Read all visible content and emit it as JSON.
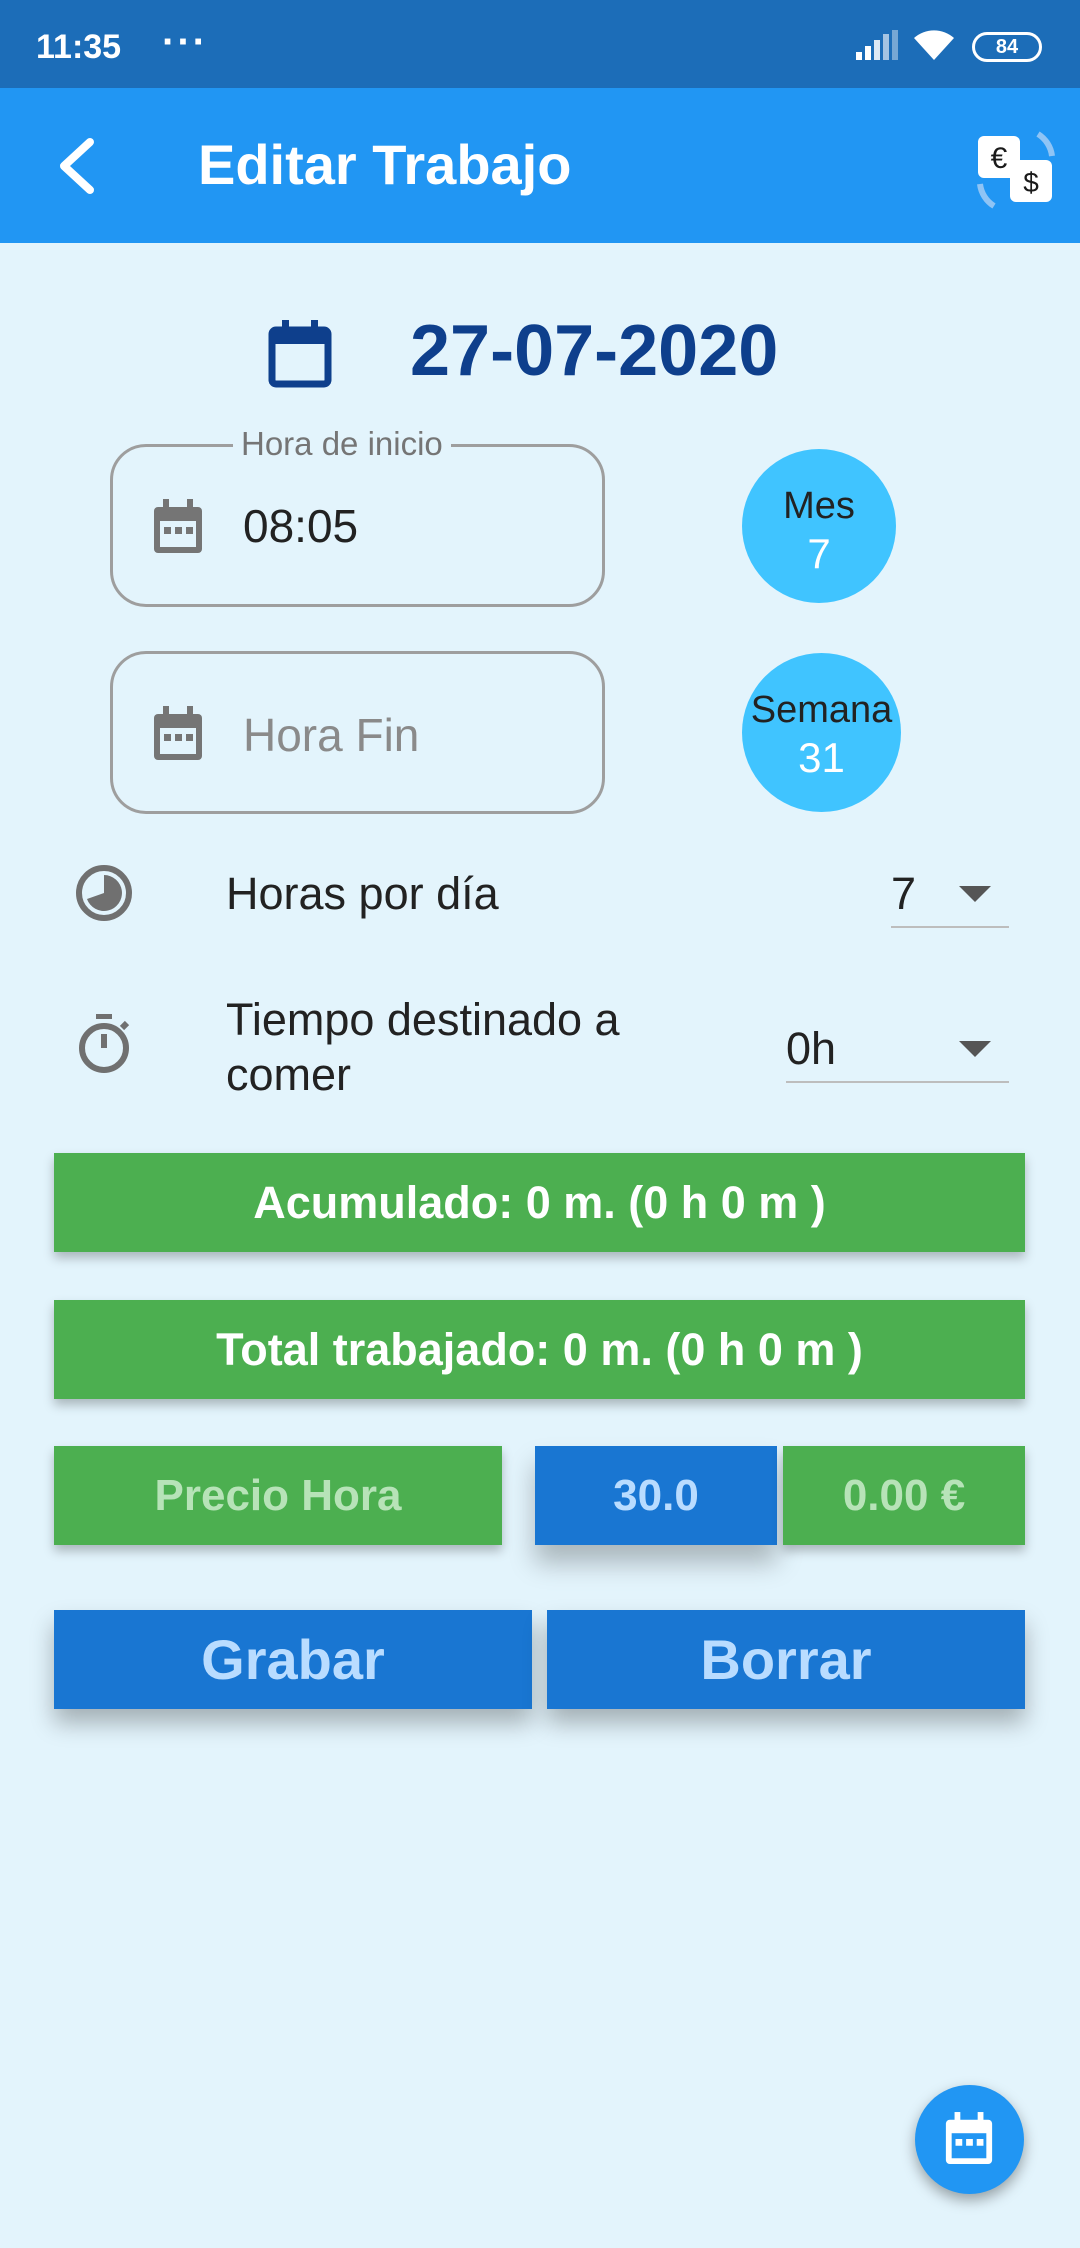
{
  "status": {
    "time": "11:35",
    "dots": "···",
    "battery": "84"
  },
  "appbar": {
    "title": "Editar Trabajo"
  },
  "date": {
    "value": "27-07-2020"
  },
  "start": {
    "label": "Hora de inicio",
    "value": "08:05"
  },
  "end": {
    "placeholder": "Hora Fin"
  },
  "mes": {
    "label": "Mes",
    "value": "7"
  },
  "semana": {
    "label": "Semana",
    "value": "31"
  },
  "horas": {
    "label": "Horas por día",
    "value": "7"
  },
  "comer": {
    "label_line1": "Tiempo destinado a",
    "label_line2": "comer",
    "value": "0h"
  },
  "acumulado": {
    "text": "Acumulado: 0 m. (0 h 0 m )"
  },
  "total": {
    "text": "Total trabajado: 0 m. (0 h 0 m )"
  },
  "precio": {
    "label": "Precio Hora",
    "rate": "30.0",
    "amount": "0.00 €"
  },
  "buttons": {
    "save": "Grabar",
    "delete": "Borrar"
  },
  "colors": {
    "appbar": "#2196f3",
    "statusbar": "#1c6db8",
    "green": "#4caf50",
    "blue": "#1976d2",
    "circle": "#40c4ff",
    "background": "#e3f4fc"
  },
  "icons": {
    "back": "arrow-back-icon",
    "currency": "currency-exchange-icon",
    "date": "calendar-icon",
    "field": "calendar-icon",
    "clock": "clock-icon",
    "timer": "timer-icon",
    "fab": "calendar-icon"
  }
}
